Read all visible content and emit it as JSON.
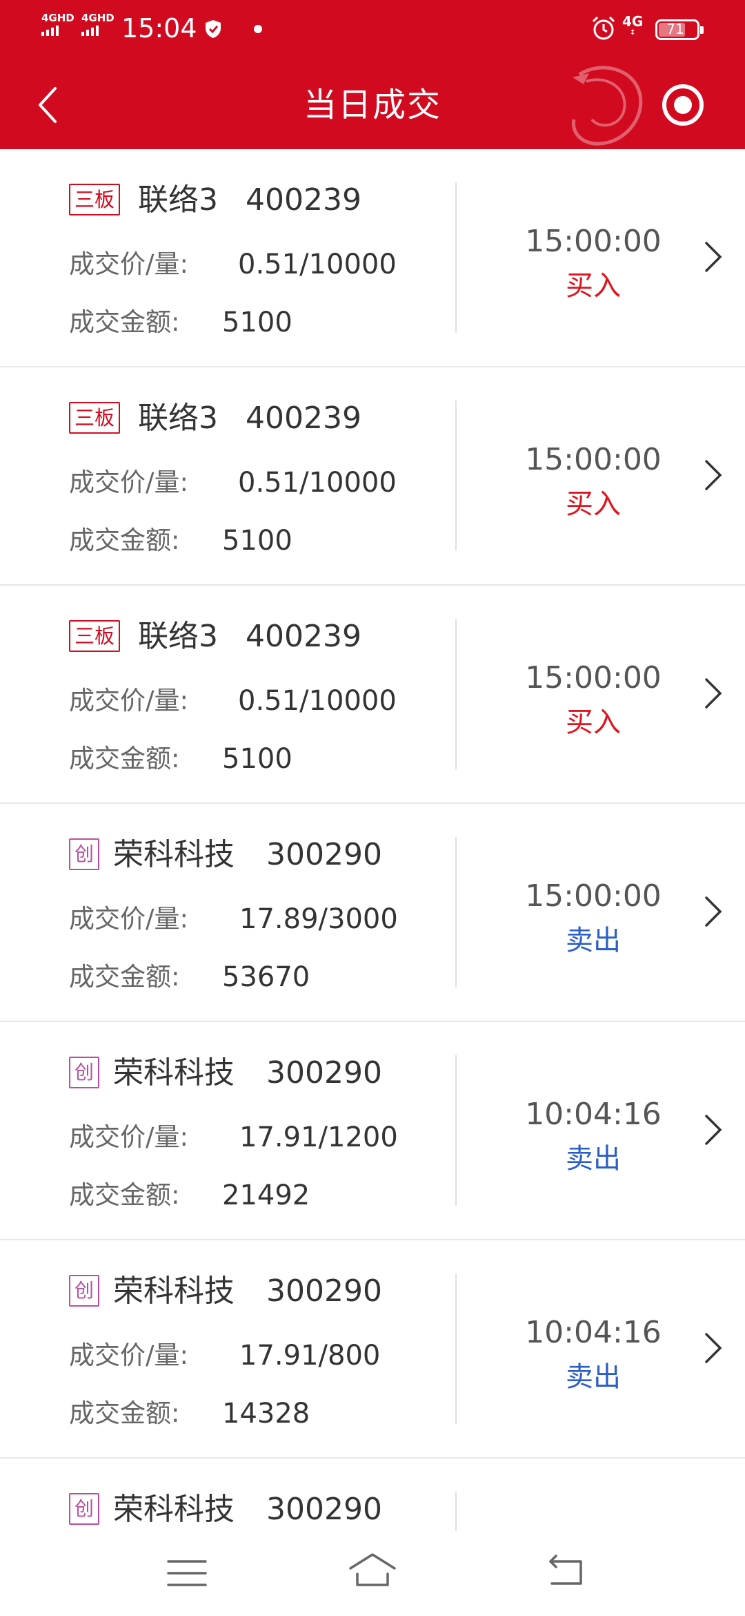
{
  "status_bar": {
    "signal1": "4GHD",
    "signal2": "4GHD",
    "time": "15:04",
    "network": "4G",
    "network_sub": "↕",
    "battery": "71"
  },
  "header": {
    "title": "当日成交"
  },
  "labels": {
    "price_qty": "成交价/量:",
    "amount": "成交金额:"
  },
  "trades": [
    {
      "board": "三板",
      "name": "联络3",
      "code": "400239",
      "price_qty": "0.51/10000",
      "amount": "5100",
      "time": "15:00:00",
      "side": "买入"
    },
    {
      "board": "三板",
      "name": "联络3",
      "code": "400239",
      "price_qty": "0.51/10000",
      "amount": "5100",
      "time": "15:00:00",
      "side": "买入"
    },
    {
      "board": "三板",
      "name": "联络3",
      "code": "400239",
      "price_qty": "0.51/10000",
      "amount": "5100",
      "time": "15:00:00",
      "side": "买入"
    },
    {
      "board": "创",
      "name": "荣科科技",
      "code": "300290",
      "price_qty": "17.89/3000",
      "amount": "53670",
      "time": "15:00:00",
      "side": "卖出"
    },
    {
      "board": "创",
      "name": "荣科科技",
      "code": "300290",
      "price_qty": "17.91/1200",
      "amount": "21492",
      "time": "10:04:16",
      "side": "卖出"
    },
    {
      "board": "创",
      "name": "荣科科技",
      "code": "300290",
      "price_qty": "17.91/800",
      "amount": "14328",
      "time": "10:04:16",
      "side": "卖出"
    },
    {
      "board": "创",
      "name": "荣科科技",
      "code": "300290"
    }
  ],
  "colors": {
    "brand_red": "#d20a1f",
    "buy": "#e0141e",
    "sell": "#2b5fc7",
    "chinext_badge": "#b94fa3"
  }
}
